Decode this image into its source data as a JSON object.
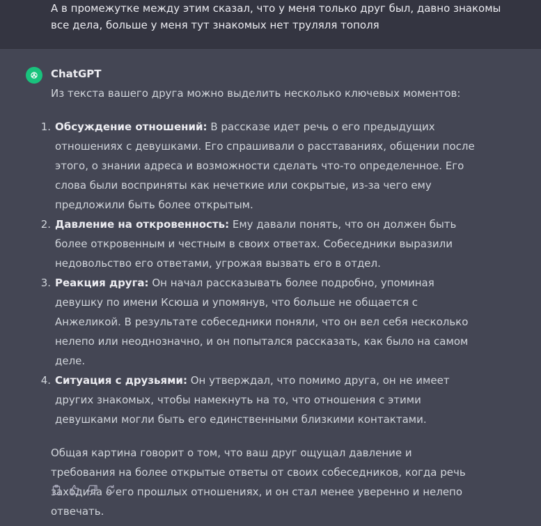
{
  "user_message": {
    "line1": "А в промежутке между этим сказал, что у меня только друг был, давно знакомы",
    "line2": "все дела, больше у меня тут знакомых нет труляля тополя"
  },
  "assistant": {
    "sender": "ChatGPT",
    "avatar_icon": "openai-logo-icon",
    "avatar_color": "#19c37d",
    "intro": "Из текста вашего друга можно выделить несколько ключевых моментов:",
    "points": [
      {
        "num": "1.",
        "lead": "Обсуждение отношений:",
        "text": " В рассказе идет речь о его предыдущих отношениях с девушками. Его спрашивали о расставаниях, общении после этого, о знании адреса и возможности сделать что-то определенное. Его слова были восприняты как нечеткие или сокрытые, из-за чего ему предложили быть более открытым."
      },
      {
        "num": "2.",
        "lead": "Давление на откровенность:",
        "text": " Ему давали понять, что он должен быть более откровенным и честным в своих ответах. Собеседники выразили недовольство его ответами, угрожая вызвать его в отдел."
      },
      {
        "num": "3.",
        "lead": "Реакция друга:",
        "text": " Он начал рассказывать более подробно, упоминая девушку по имени Ксюша и упомянув, что больше не общается с Анжеликой. В результате собеседники поняли, что он вел себя несколько нелепо или неоднозначно, и он попытался рассказать, как было на самом деле."
      },
      {
        "num": "4.",
        "lead": "Ситуация с друзьями:",
        "text": " Он утверждал, что помимо друга, он не имеет других знакомых, чтобы намекнуть на то, что отношения с этими девушками могли быть его единственными близкими контактами."
      }
    ],
    "summary": "Общая картина говорит о том, что ваш друг ощущал давление и требования на более открытые ответы от своих собеседников, когда речь заходила о его прошлых отношениях, и он стал менее уверенно и нелепо отвечать."
  },
  "actions": [
    "copy-icon",
    "thumbs-up-icon",
    "thumbs-down-icon",
    "regenerate-icon"
  ],
  "colors": {
    "background": "#343541",
    "assistant_background": "#444654",
    "text": "#d1d5db",
    "accent": "#19c37d"
  }
}
